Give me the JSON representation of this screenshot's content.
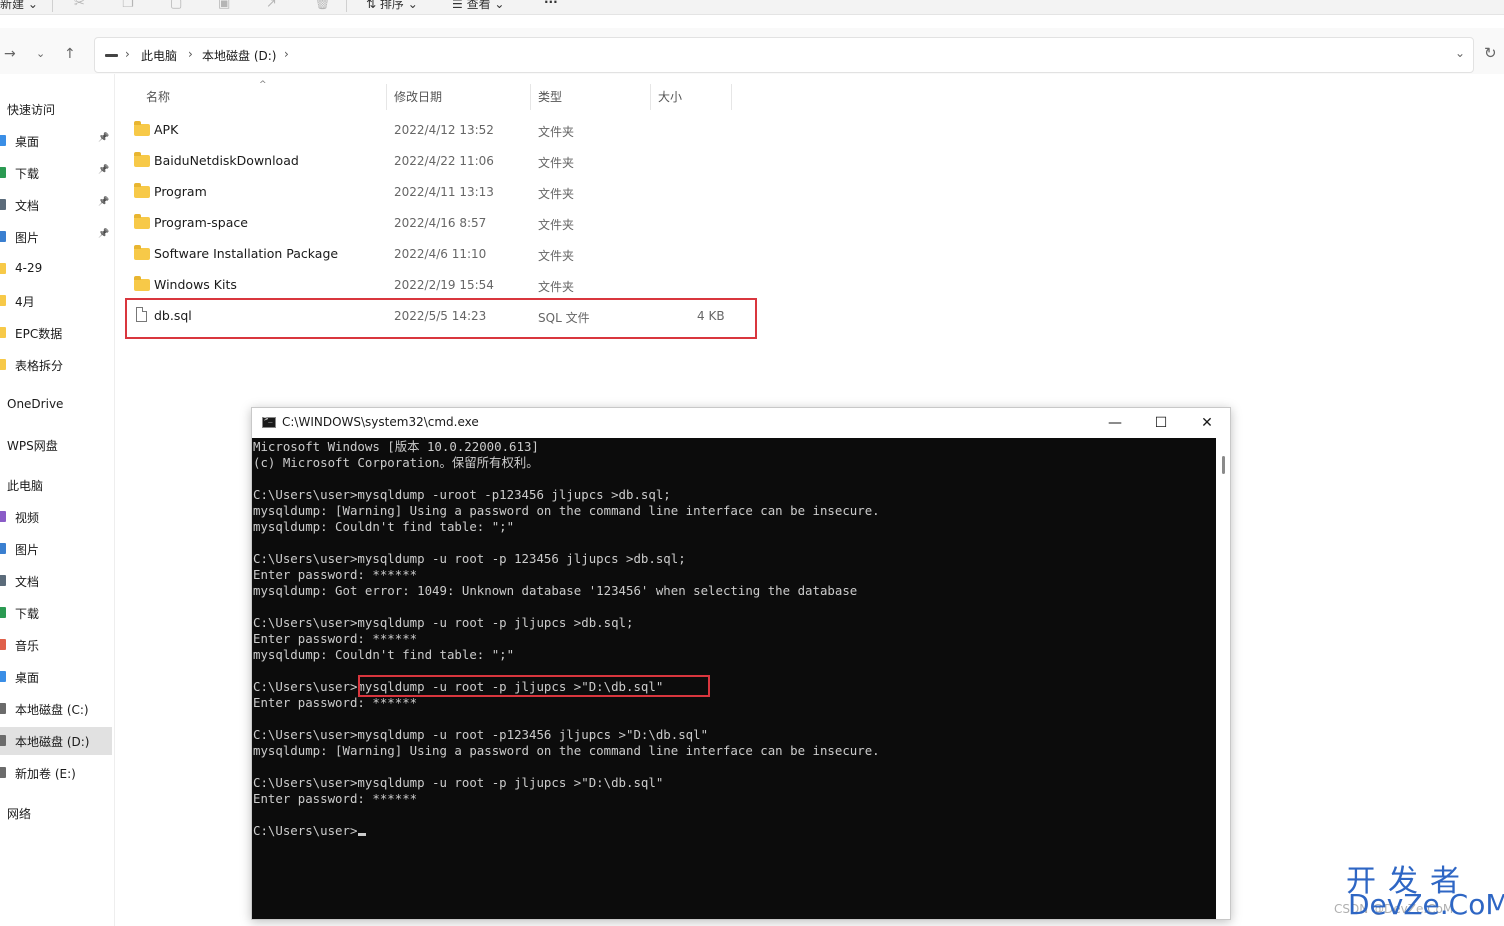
{
  "toolbar": {
    "new_label": "新建",
    "sort_label": "排序",
    "view_label": "查看",
    "more_label": "···"
  },
  "address": {
    "crumbs": [
      "此电脑",
      "本地磁盘 (D:)"
    ]
  },
  "sidebar": {
    "items": [
      {
        "label": "快速访问",
        "icon": "star-icon"
      },
      {
        "label": "桌面",
        "icon": "desktop-icon",
        "pinned": true
      },
      {
        "label": "下载",
        "icon": "download-icon",
        "pinned": true
      },
      {
        "label": "文档",
        "icon": "document-icon",
        "pinned": true
      },
      {
        "label": "图片",
        "icon": "picture-icon",
        "pinned": true
      },
      {
        "label": "4-29",
        "icon": "folder-icon"
      },
      {
        "label": "4月",
        "icon": "folder-icon"
      },
      {
        "label": "EPC数据",
        "icon": "folder-icon"
      },
      {
        "label": "表格拆分",
        "icon": "folder-icon"
      },
      {
        "label": "OneDrive",
        "icon": "cloud-icon"
      },
      {
        "label": "WPS网盘",
        "icon": "cloud-icon"
      },
      {
        "label": "此电脑",
        "icon": "computer-icon"
      },
      {
        "label": "视频",
        "icon": "video-icon"
      },
      {
        "label": "图片",
        "icon": "picture-icon"
      },
      {
        "label": "文档",
        "icon": "document-icon"
      },
      {
        "label": "下载",
        "icon": "download-icon"
      },
      {
        "label": "音乐",
        "icon": "music-icon"
      },
      {
        "label": "桌面",
        "icon": "desktop-icon"
      },
      {
        "label": "本地磁盘 (C:)",
        "icon": "drive-icon"
      },
      {
        "label": "本地磁盘 (D:)",
        "icon": "drive-icon",
        "selected": true
      },
      {
        "label": "新加卷 (E:)",
        "icon": "drive-icon"
      },
      {
        "label": "网络",
        "icon": "network-icon"
      }
    ]
  },
  "files": {
    "columns": [
      "名称",
      "修改日期",
      "类型",
      "大小"
    ],
    "rows": [
      {
        "name": "APK",
        "date": "2022/4/12 13:52",
        "type": "文件夹",
        "size": "",
        "kind": "folder"
      },
      {
        "name": "BaiduNetdiskDownload",
        "date": "2022/4/22 11:06",
        "type": "文件夹",
        "size": "",
        "kind": "folder"
      },
      {
        "name": "Program",
        "date": "2022/4/11 13:13",
        "type": "文件夹",
        "size": "",
        "kind": "folder"
      },
      {
        "name": "Program-space",
        "date": "2022/4/16 8:57",
        "type": "文件夹",
        "size": "",
        "kind": "folder"
      },
      {
        "name": "Software Installation Package",
        "date": "2022/4/6 11:10",
        "type": "文件夹",
        "size": "",
        "kind": "folder"
      },
      {
        "name": "Windows Kits",
        "date": "2022/2/19 15:54",
        "type": "文件夹",
        "size": "",
        "kind": "folder"
      },
      {
        "name": "db.sql",
        "date": "2022/5/5 14:23",
        "type": "SQL 文件",
        "size": "4 KB",
        "kind": "file"
      }
    ]
  },
  "cmd": {
    "title": "C:\\WINDOWS\\system32\\cmd.exe",
    "lines": [
      "Microsoft Windows [版本 10.0.22000.613]",
      "(c) Microsoft Corporation。保留所有权利。",
      "",
      "C:\\Users\\user>mysqldump -uroot -p123456 jljupcs >db.sql;",
      "mysqldump: [Warning] Using a password on the command line interface can be insecure.",
      "mysqldump: Couldn't find table: \";\"",
      "",
      "C:\\Users\\user>mysqldump -u root -p 123456 jljupcs >db.sql;",
      "Enter password: ******",
      "mysqldump: Got error: 1049: Unknown database '123456' when selecting the database",
      "",
      "C:\\Users\\user>mysqldump -u root -p jljupcs >db.sql;",
      "Enter password: ******",
      "mysqldump: Couldn't find table: \";\"",
      "",
      "C:\\Users\\user>mysqldump -u root -p jljupcs >\"D:\\db.sql\"",
      "Enter password: ******",
      "",
      "C:\\Users\\user>mysqldump -u root -p123456 jljupcs >\"D:\\db.sql\"",
      "mysqldump: [Warning] Using a password on the command line interface can be insecure.",
      "",
      "C:\\Users\\user>mysqldump -u root -p jljupcs >\"D:\\db.sql\"",
      "Enter password: ******",
      "",
      "C:\\Users\\user>"
    ]
  },
  "watermark": {
    "line1": "开发者",
    "line2": "DevZe.CoM",
    "line3": "CSDN @DevZe.CoM"
  },
  "colors": {
    "highlight": "#d9363e",
    "folder": "#f7c948",
    "console_bg": "#0c0c0c",
    "console_fg": "#cccccc",
    "watermark": "#2e66c4"
  }
}
